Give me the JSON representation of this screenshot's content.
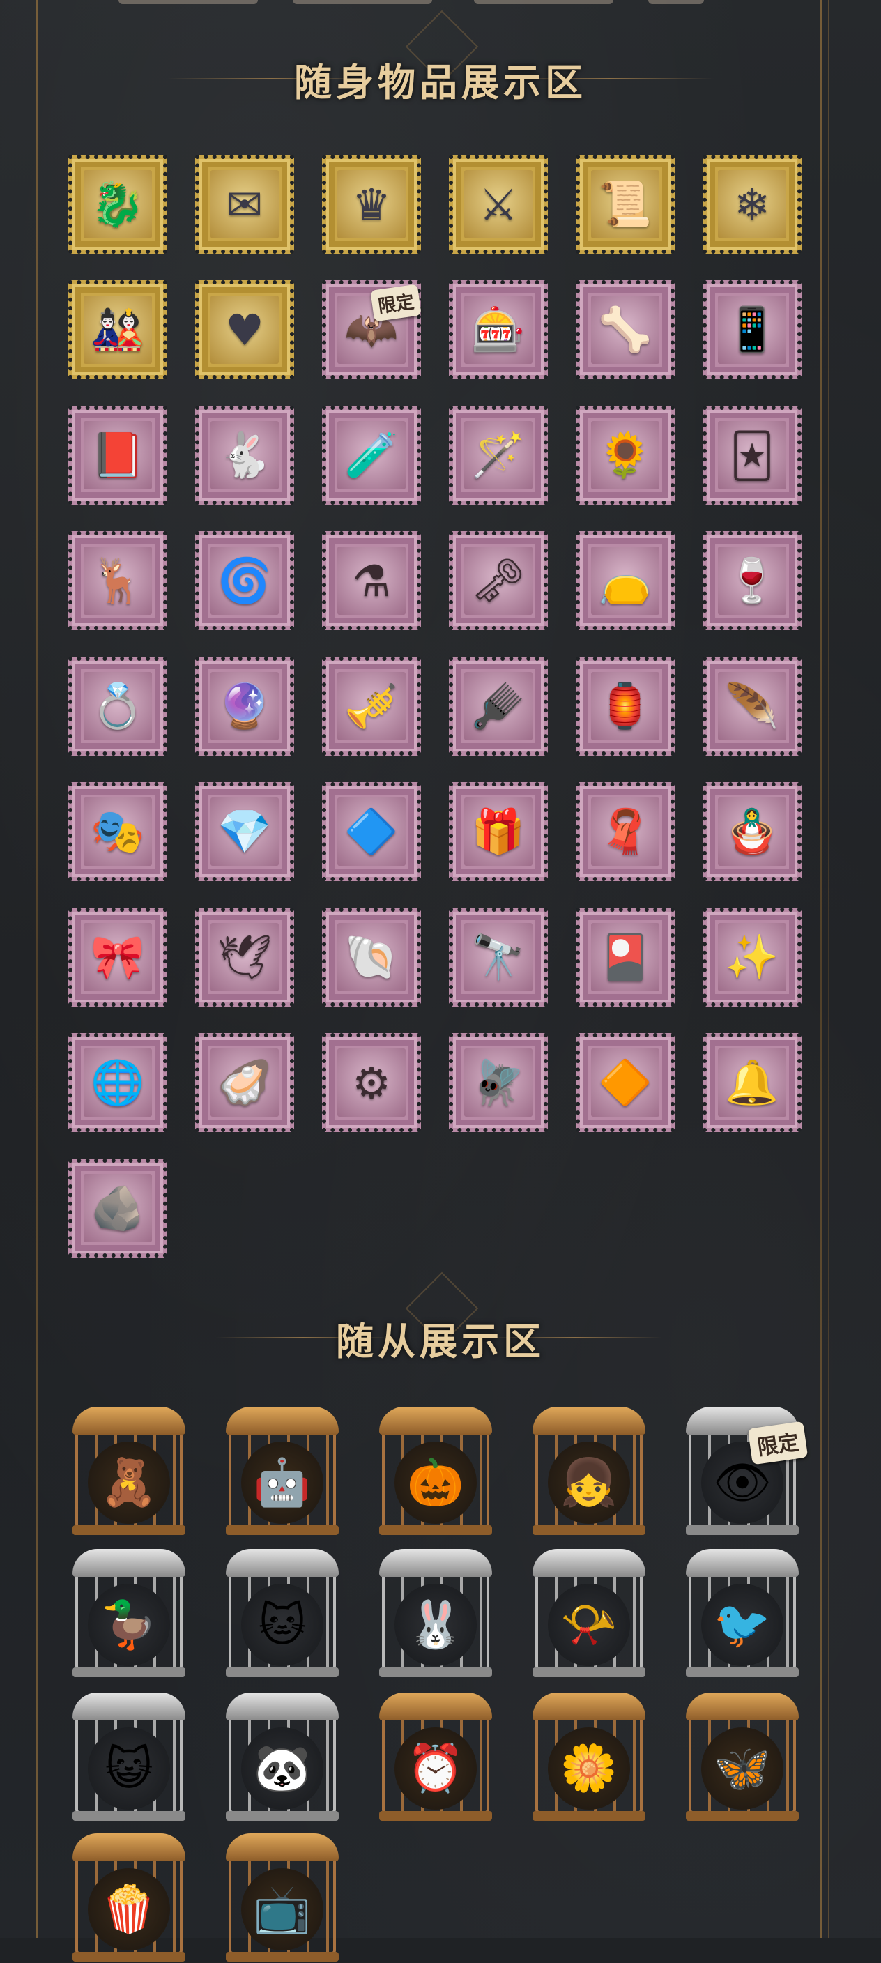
{
  "sections": {
    "accessories_title": "随身物品展示区",
    "pets_title": "随从展示区"
  },
  "badge_label": "限定",
  "accessories": [
    {
      "name": "blue-serpent-charm",
      "frame": "gold",
      "icon": "🐉"
    },
    {
      "name": "winged-letter",
      "frame": "gold",
      "icon": "✉"
    },
    {
      "name": "fire-crown",
      "frame": "gold",
      "icon": "♛"
    },
    {
      "name": "scythe",
      "frame": "gold",
      "icon": "⚔"
    },
    {
      "name": "burning-scroll",
      "frame": "gold",
      "icon": "📜"
    },
    {
      "name": "crystal-cluster",
      "frame": "gold",
      "icon": "❄"
    },
    {
      "name": "doll-figure",
      "frame": "gold",
      "icon": "🎎"
    },
    {
      "name": "ice-heart",
      "frame": "gold",
      "icon": "♥"
    },
    {
      "name": "winged-doll",
      "frame": "pink",
      "icon": "🦇",
      "limited": true
    },
    {
      "name": "arcade-box",
      "frame": "pink",
      "icon": "🎰"
    },
    {
      "name": "bone-tail",
      "frame": "pink",
      "icon": "🦴"
    },
    {
      "name": "flip-phone",
      "frame": "pink",
      "icon": "📱"
    },
    {
      "name": "red-book",
      "frame": "pink",
      "icon": "📕"
    },
    {
      "name": "rabbit-mask",
      "frame": "pink",
      "icon": "🐇"
    },
    {
      "name": "potion-jar",
      "frame": "pink",
      "icon": "🧪"
    },
    {
      "name": "blue-wand",
      "frame": "pink",
      "icon": "🪄"
    },
    {
      "name": "watering-can",
      "frame": "pink",
      "icon": "🌻"
    },
    {
      "name": "tarot-card",
      "frame": "pink",
      "icon": "🃏"
    },
    {
      "name": "antler-mask",
      "frame": "pink",
      "icon": "🦌"
    },
    {
      "name": "hypnotic-spiral",
      "frame": "pink",
      "icon": "🌀"
    },
    {
      "name": "ornate-vial",
      "frame": "pink",
      "icon": "⚗"
    },
    {
      "name": "ancient-key",
      "frame": "pink",
      "icon": "🗝"
    },
    {
      "name": "dark-pouch",
      "frame": "pink",
      "icon": "👝"
    },
    {
      "name": "goblet",
      "frame": "pink",
      "icon": "🍷"
    },
    {
      "name": "gold-ring",
      "frame": "pink",
      "icon": "💍"
    },
    {
      "name": "glowing-bottle",
      "frame": "pink",
      "icon": "🔮"
    },
    {
      "name": "silver-flute",
      "frame": "pink",
      "icon": "🎺"
    },
    {
      "name": "golden-comb",
      "frame": "pink",
      "icon": "🪮"
    },
    {
      "name": "lantern-chain",
      "frame": "pink",
      "icon": "🏮"
    },
    {
      "name": "quill-feather",
      "frame": "pink",
      "icon": "🪶"
    },
    {
      "name": "iron-mask",
      "frame": "pink",
      "icon": "🎭"
    },
    {
      "name": "sapphire-gem",
      "frame": "pink",
      "icon": "💎"
    },
    {
      "name": "pendant-crystal",
      "frame": "pink",
      "icon": "🔷"
    },
    {
      "name": "music-box",
      "frame": "pink",
      "icon": "🎁"
    },
    {
      "name": "red-cape",
      "frame": "pink",
      "icon": "🧣"
    },
    {
      "name": "puppet-doll",
      "frame": "pink",
      "icon": "🪆"
    },
    {
      "name": "gift-box",
      "frame": "pink",
      "icon": "🎀"
    },
    {
      "name": "silver-bird",
      "frame": "pink",
      "icon": "🕊"
    },
    {
      "name": "shell-horn",
      "frame": "pink",
      "icon": "🐚"
    },
    {
      "name": "spyglass",
      "frame": "pink",
      "icon": "🔭"
    },
    {
      "name": "card-case",
      "frame": "pink",
      "icon": "🎴"
    },
    {
      "name": "frost-mace",
      "frame": "pink",
      "icon": "✨"
    },
    {
      "name": "brass-globe",
      "frame": "pink",
      "icon": "🌐"
    },
    {
      "name": "pearl-clam",
      "frame": "pink",
      "icon": "🦪"
    },
    {
      "name": "clockwork-heart",
      "frame": "pink",
      "icon": "⚙"
    },
    {
      "name": "dragonfly",
      "frame": "pink",
      "icon": "🪰"
    },
    {
      "name": "amber-crystal",
      "frame": "pink",
      "icon": "🔶"
    },
    {
      "name": "bronze-bell",
      "frame": "pink",
      "icon": "🔔"
    },
    {
      "name": "stone-shard",
      "frame": "pink",
      "icon": "🪨"
    }
  ],
  "pets": [
    {
      "name": "pink-bear",
      "cage": "brass",
      "icon": "🧸"
    },
    {
      "name": "robot",
      "cage": "brass",
      "icon": "🤖"
    },
    {
      "name": "flame-pumpkin",
      "cage": "brass",
      "icon": "🎃"
    },
    {
      "name": "red-dress-doll",
      "cage": "brass",
      "icon": "👧"
    },
    {
      "name": "eyeball-creature",
      "cage": "silver",
      "icon": "👁",
      "limited": true
    },
    {
      "name": "yellow-duck",
      "cage": "silver",
      "icon": "🦆"
    },
    {
      "name": "ghost-cat",
      "cage": "silver",
      "icon": "🐱"
    },
    {
      "name": "white-rabbit",
      "cage": "silver",
      "icon": "🐰"
    },
    {
      "name": "gramophone",
      "cage": "silver",
      "icon": "📯"
    },
    {
      "name": "blue-bird",
      "cage": "silver",
      "icon": "🐦"
    },
    {
      "name": "king-cat",
      "cage": "silver",
      "icon": "😺"
    },
    {
      "name": "panda",
      "cage": "silver",
      "icon": "🐼"
    },
    {
      "name": "clock",
      "cage": "brass",
      "icon": "⏰"
    },
    {
      "name": "golden-flower",
      "cage": "brass",
      "icon": "🌼"
    },
    {
      "name": "butterfly",
      "cage": "brass",
      "icon": "🦋"
    },
    {
      "name": "popcorn",
      "cage": "brass",
      "icon": "🍿"
    },
    {
      "name": "tv-set",
      "cage": "brass",
      "icon": "📺"
    }
  ]
}
